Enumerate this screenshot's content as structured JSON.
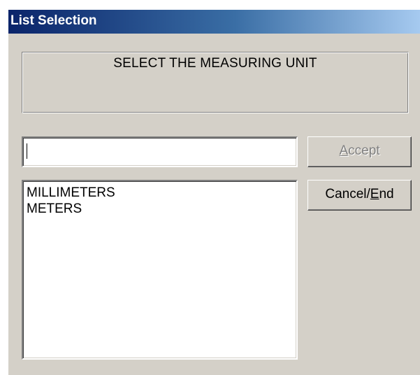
{
  "window": {
    "title": "List Selection"
  },
  "prompt": {
    "text": "SELECT THE MEASURING UNIT"
  },
  "entry": {
    "value": ""
  },
  "buttons": {
    "accept": {
      "mnemonic": "A",
      "rest": "ccept",
      "enabled": false
    },
    "cancel": {
      "before": "Cancel/",
      "mnemonic": "E",
      "rest": "nd",
      "enabled": true
    }
  },
  "list": {
    "items": [
      "MILLIMETERS",
      "METERS"
    ]
  },
  "colors": {
    "title_start": "#0a246a",
    "title_end": "#a6caf0",
    "face": "#d4d0c8",
    "disabled_text": "#808080"
  }
}
